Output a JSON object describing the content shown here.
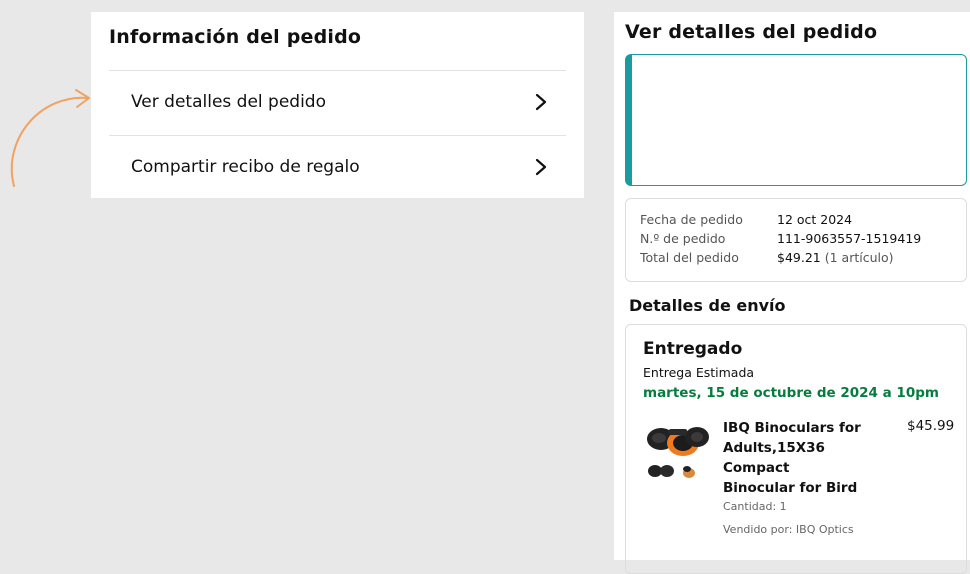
{
  "order_info": {
    "title": "Información del pedido",
    "rows": [
      {
        "label": "Ver detalles del pedido"
      },
      {
        "label": "Compartir recibo de regalo"
      }
    ]
  },
  "details": {
    "title": "Ver detalles del pedido",
    "summary": {
      "date_label": "Fecha de pedido",
      "date_value": "12 oct 2024",
      "number_label": "N.º de pedido",
      "number_value": "111-9063557-1519419",
      "total_label": "Total del pedido",
      "total_value": "$49.21",
      "total_note": "(1 artículo)"
    },
    "shipping_title": "Detalles de envío",
    "shipment": {
      "status": "Entregado",
      "estimate_label": "Entrega Estimada",
      "estimate_date": "martes, 15 de octubre de 2024 a 10pm",
      "product": {
        "name": "IBQ Binoculars for Adults,15X36 Compact Binocular for Bird",
        "price": "$45.99",
        "quantity": "Cantidad: 1",
        "seller": "Vendido por: IBQ Optics"
      }
    }
  },
  "colors": {
    "accent_teal": "#1a9aa1",
    "delivery_green": "#067d3e",
    "arrow_orange": "#f0a262"
  },
  "icons": [
    "chevron-right-icon",
    "curved-arrow-icon",
    "binoculars-image"
  ]
}
